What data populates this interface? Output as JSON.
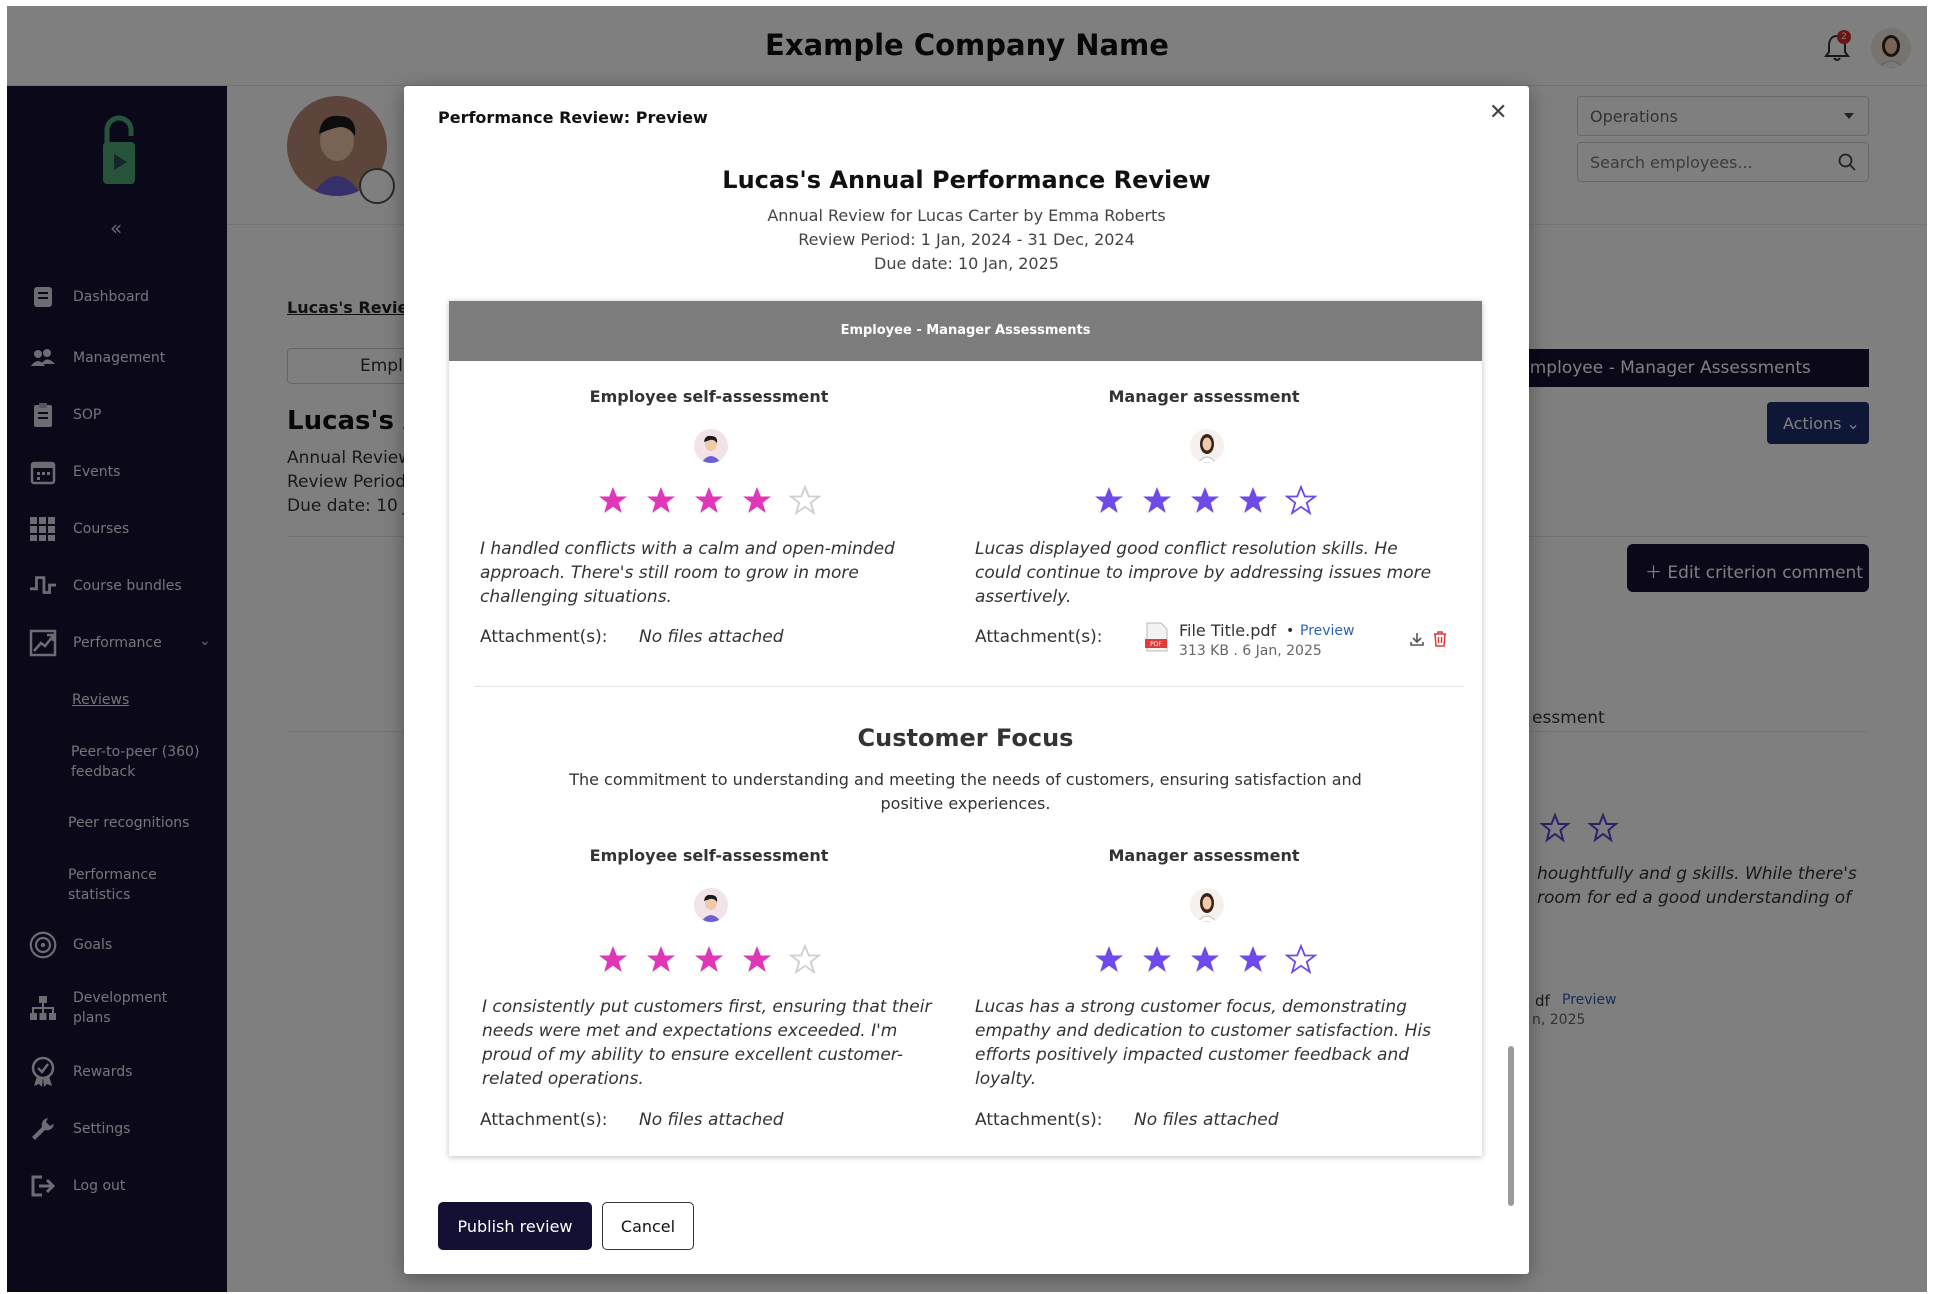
{
  "header": {
    "company_name": "Example Company Name",
    "notification_count": "2"
  },
  "sidebar": {
    "items": [
      {
        "label": "Dashboard",
        "icon": "dashboard-icon"
      },
      {
        "label": "Management",
        "icon": "people-icon"
      },
      {
        "label": "SOP",
        "icon": "clipboard-icon"
      },
      {
        "label": "Events",
        "icon": "calendar-icon"
      },
      {
        "label": "Courses",
        "icon": "grid-icon"
      },
      {
        "label": "Course bundles",
        "icon": "bundle-icon"
      },
      {
        "label": "Performance",
        "icon": "chart-icon"
      },
      {
        "label": "Goals",
        "icon": "target-icon"
      },
      {
        "label": "Development plans",
        "icon": "hierarchy-icon"
      },
      {
        "label": "Rewards",
        "icon": "award-icon"
      },
      {
        "label": "Settings",
        "icon": "wrench-icon"
      },
      {
        "label": "Log out",
        "icon": "logout-icon"
      }
    ],
    "performance_sub": [
      "Reviews",
      "Peer-to-peer (360) feedback",
      "Peer recognitions",
      "Performance statistics"
    ]
  },
  "background": {
    "department_select": "Operations",
    "search_placeholder": "Search employees...",
    "breadcrumb": "Lucas's Review",
    "tab_label": "Empl",
    "page_title": "Lucas's A",
    "meta_line1": "Annual Review",
    "meta_line2": "Review Period:",
    "meta_line3": "Due date: 10 Ja",
    "assessments_pill": "Employee - Manager Assessments",
    "actions_label": "Actions",
    "edit_comment_label": "Edit criterion comment",
    "partial_assessment": "essment",
    "partial_comment": "houghtfully and g skills. While there's room for ed a good understanding of",
    "partial_file": "df",
    "partial_preview": "Preview",
    "partial_date": "n, 2025"
  },
  "modal": {
    "title": "Performance Review: Preview",
    "review_title": "Lucas's Annual Performance Review",
    "subtitle": "Annual Review for Lucas Carter by Emma Roberts",
    "period": "Review Period: 1 Jan, 2024 - 31 Dec, 2024",
    "due": "Due date: 10 Jan, 2025",
    "panel_header": "Employee - Manager Assessments",
    "publish_label": "Publish review",
    "cancel_label": "Cancel",
    "colors": {
      "employee_star": "#e036b8",
      "manager_star": "#7049ea",
      "primary": "#141033"
    },
    "criteria": [
      {
        "name": "",
        "description": "",
        "employee": {
          "heading": "Employee self-assessment",
          "rating": 4,
          "max": 5,
          "comment": "I handled conflicts with a calm and open-minded approach. There's still room to grow in more challenging situations.",
          "attachment_label": "Attachment(s):",
          "attachment_value": "No files attached"
        },
        "manager": {
          "heading": "Manager assessment",
          "rating": 4,
          "max": 5,
          "comment": "Lucas displayed good conflict resolution skills. He could continue to improve by addressing issues more assertively.",
          "attachment_label": "Attachment(s):",
          "file_name": "File Title.pdf",
          "file_preview": "Preview",
          "file_meta": "313 KB . 6 Jan, 2025"
        }
      },
      {
        "name": "Customer Focus",
        "description": "The commitment to understanding and meeting the needs of customers, ensuring satisfaction and positive experiences.",
        "employee": {
          "heading": "Employee self-assessment",
          "rating": 4,
          "max": 5,
          "comment": "I consistently put customers first, ensuring that their needs were met and expectations exceeded. I'm proud of my ability to ensure excellent customer-related operations.",
          "attachment_label": "Attachment(s):",
          "attachment_value": "No files attached"
        },
        "manager": {
          "heading": "Manager assessment",
          "rating": 4,
          "max": 5,
          "comment": "Lucas has a strong customer focus, demonstrating empathy and dedication to customer satisfaction. His efforts positively impacted customer feedback and loyalty.",
          "attachment_label": "Attachment(s):",
          "attachment_value": "No files attached"
        }
      }
    ]
  }
}
